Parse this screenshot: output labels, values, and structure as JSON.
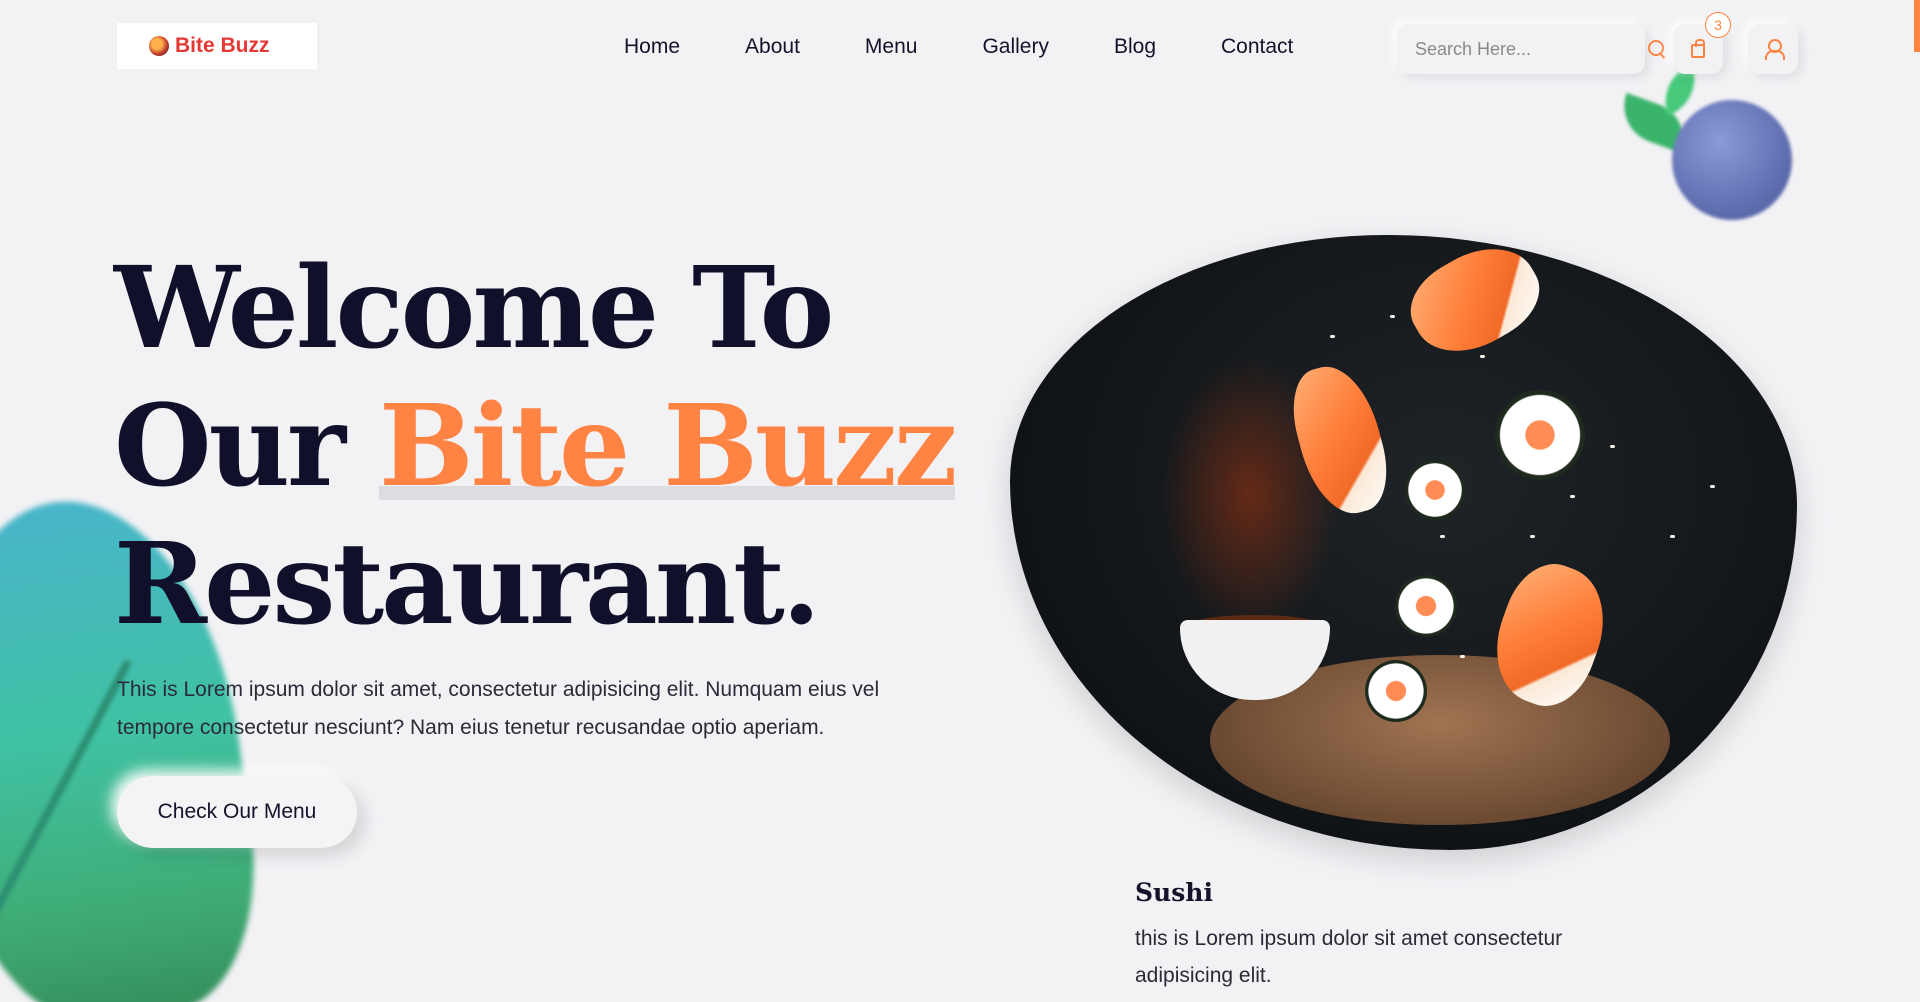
{
  "brand": {
    "name": "Bite Buzz",
    "logo_icon": "burger-logo-icon"
  },
  "nav": {
    "items": [
      {
        "label": "Home"
      },
      {
        "label": "About"
      },
      {
        "label": "Menu"
      },
      {
        "label": "Gallery"
      },
      {
        "label": "Blog"
      },
      {
        "label": "Contact"
      }
    ]
  },
  "search": {
    "placeholder": "Search Here...",
    "value": ""
  },
  "cart": {
    "count": "3"
  },
  "hero": {
    "title_line1": "Welcome To",
    "title_line2_prefix": "Our ",
    "title_highlight": "Bite Buzz",
    "title_line3": "Restaurant.",
    "description": "This is Lorem ipsum dolor sit amet, consectetur adipisicing elit. Numquam eius vel tempore consectetur nesciunt? Nam eius tenetur recusandae optio aperiam.",
    "cta_label": "Check Our Menu"
  },
  "featured": {
    "title": "Sushi",
    "description": "this is Lorem ipsum dolor sit amet consectetur adipisicing elit."
  },
  "colors": {
    "accent": "#ff8342",
    "text": "#11102b",
    "background": "#f2f1f4"
  }
}
